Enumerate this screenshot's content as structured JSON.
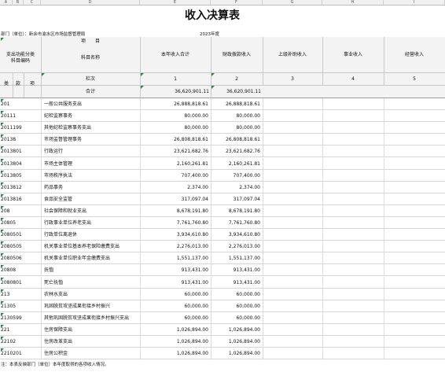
{
  "columns": [
    "A",
    "B",
    "C",
    "D",
    "E",
    "F",
    "G",
    "H",
    "I"
  ],
  "title": "收入决算表",
  "meta": {
    "dept": "部门（单位）：新余市渝水区市场监督管理局",
    "year": "2023年度"
  },
  "header": {
    "xiangmu": "项　　目",
    "code_header": "支出功能分类\n科目编码",
    "name_header": "科目名称",
    "col1": "本年收入合计",
    "col2": "财政拨款收入",
    "col3": "上级补助收入",
    "col4": "事业收入",
    "col5": "经营收入",
    "lei": "类",
    "kuan": "款",
    "xiang": "项",
    "lanci": "栏次",
    "heji": "合计",
    "nums": [
      "1",
      "2",
      "3",
      "4",
      "5"
    ],
    "total_1": "36,620,901.11",
    "total_2": "36,620,901.11"
  },
  "rows": [
    {
      "code": "201",
      "name": "一般公共服务支出",
      "v1": "26,888,818.61",
      "v2": "26,888,818.61"
    },
    {
      "code": "20111",
      "name": "纪检监察事务",
      "v1": "80,000.00",
      "v2": "80,000.00"
    },
    {
      "code": "2011199",
      "name": "其他纪检监察事务支出",
      "v1": "80,000.00",
      "v2": "80,000.00"
    },
    {
      "code": "20138",
      "name": "市场监督管理事务",
      "v1": "26,808,818.61",
      "v2": "26,808,818.61"
    },
    {
      "code": "2013801",
      "name": "行政运行",
      "v1": "23,621,682.76",
      "v2": "23,621,682.76"
    },
    {
      "code": "2013804",
      "name": "市场主体管理",
      "v1": "2,160,261.81",
      "v2": "2,160,261.81"
    },
    {
      "code": "2013805",
      "name": "市场秩序执法",
      "v1": "707,400.00",
      "v2": "707,400.00"
    },
    {
      "code": "2013812",
      "name": "药品事务",
      "v1": "2,374.00",
      "v2": "2,374.00"
    },
    {
      "code": "2013816",
      "name": "食品安全监管",
      "v1": "317,097.04",
      "v2": "317,097.04"
    },
    {
      "code": "208",
      "name": "社会保障和就业支出",
      "v1": "8,678,191.80",
      "v2": "8,678,191.80"
    },
    {
      "code": "20805",
      "name": "行政事业单位养老支出",
      "v1": "7,761,760.80",
      "v2": "7,761,760.80"
    },
    {
      "code": "2080501",
      "name": "行政单位离退休",
      "v1": "3,934,610.80",
      "v2": "3,934,610.80"
    },
    {
      "code": "2080505",
      "name": "机关事业单位基本养老保险缴费支出",
      "v1": "2,276,013.00",
      "v2": "2,276,013.00"
    },
    {
      "code": "2080506",
      "name": "机关事业单位职业年金缴费支出",
      "v1": "1,551,137.00",
      "v2": "1,551,137.00"
    },
    {
      "code": "20808",
      "name": "抚恤",
      "v1": "913,431.00",
      "v2": "913,431.00"
    },
    {
      "code": "2080801",
      "name": "死亡抚恤",
      "v1": "913,431.00",
      "v2": "913,431.00"
    },
    {
      "code": "213",
      "name": "农林水支出",
      "v1": "60,000.00",
      "v2": "60,000.00"
    },
    {
      "code": "21305",
      "name": "巩固脱贫攻坚成果衔接乡村振兴",
      "v1": "60,000.00",
      "v2": "60,000.00"
    },
    {
      "code": "2130599",
      "name": "其他巩固脱贫攻坚成果衔接乡村振兴支出",
      "v1": "60,000.00",
      "v2": "60,000.00"
    },
    {
      "code": "221",
      "name": "住房保障支出",
      "v1": "1,026,894.00",
      "v2": "1,026,894.00"
    },
    {
      "code": "22102",
      "name": "住房改革支出",
      "v1": "1,026,894.00",
      "v2": "1,026,894.00"
    },
    {
      "code": "2210201",
      "name": "住房公积金",
      "v1": "1,026,894.00",
      "v2": "1,026,894.00"
    }
  ],
  "footer": "注：本表反映部门（单位）本年度取得的各项收入情况。",
  "colors": {
    "marker": "#1f8a3b",
    "header_bg": "#f3f3f3",
    "grid": "#d6d6d6"
  }
}
